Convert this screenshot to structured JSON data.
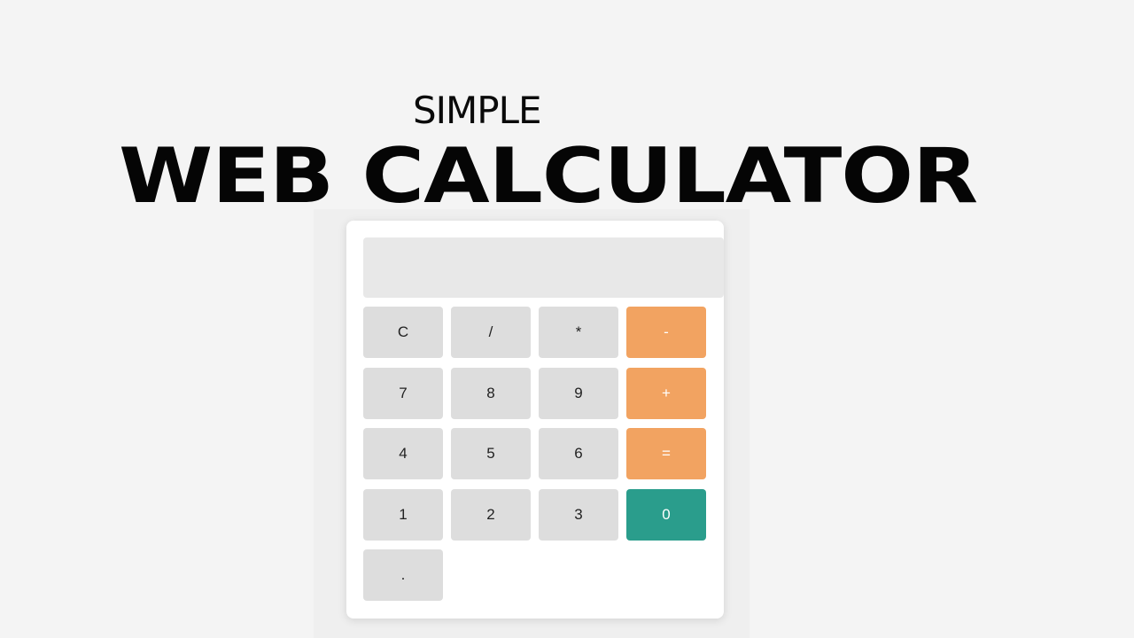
{
  "header": {
    "subtitle": "SIMPLE",
    "title": "WEB CALCULATOR"
  },
  "calculator": {
    "display_value": "",
    "keys": {
      "clear": "C",
      "divide": "/",
      "multiply": "*",
      "subtract": "-",
      "seven": "7",
      "eight": "8",
      "nine": "9",
      "add": "+",
      "four": "4",
      "five": "5",
      "six": "6",
      "equals": "=",
      "one": "1",
      "two": "2",
      "three": "3",
      "zero": "0",
      "decimal": "."
    }
  },
  "colors": {
    "background": "#f4f4f4",
    "key_default": "#dddddd",
    "key_operator": "#f2a361",
    "key_zero": "#2a9d8c",
    "display_bg": "#e8e8e8"
  }
}
